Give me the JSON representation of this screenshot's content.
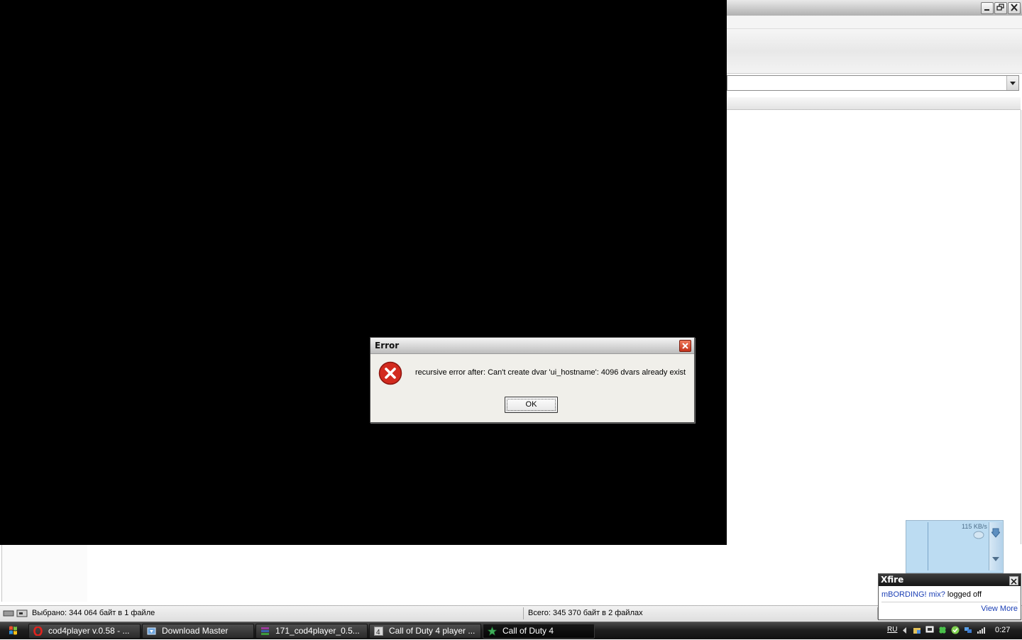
{
  "dialog": {
    "title": "Error",
    "message": "recursive error after: Can't create dvar 'ui_hostname': 4096 dvars already exist",
    "ok_label": "OK"
  },
  "statusbar": {
    "selected": "Выбрано: 344 064 байт в 1 файле",
    "total": "Всего: 345 370 байт в 2 файлах"
  },
  "taskbar": {
    "items": [
      {
        "label": "cod4player v.0.58 - ...",
        "icon": "opera-icon"
      },
      {
        "label": "Download Master",
        "icon": "download-master-icon"
      },
      {
        "label": "171_cod4player_0.5...",
        "icon": "winrar-icon"
      },
      {
        "label": "Call of Duty 4 player ...",
        "icon": "cod4-icon"
      },
      {
        "label": "Call of Duty 4",
        "icon": "cod4-star-icon"
      }
    ],
    "tray": {
      "language": "RU",
      "clock": "0:27"
    }
  },
  "xfire": {
    "speed": "115 KB/s",
    "popup_title": "Xfire",
    "user": "mBORDING! mix?",
    "status": "logged off",
    "view_more": "View More"
  },
  "colors": {
    "error_red": "#d22a1e",
    "taskbar_bg": "#1f1f1f",
    "xfire_link": "#1b3fb5"
  }
}
